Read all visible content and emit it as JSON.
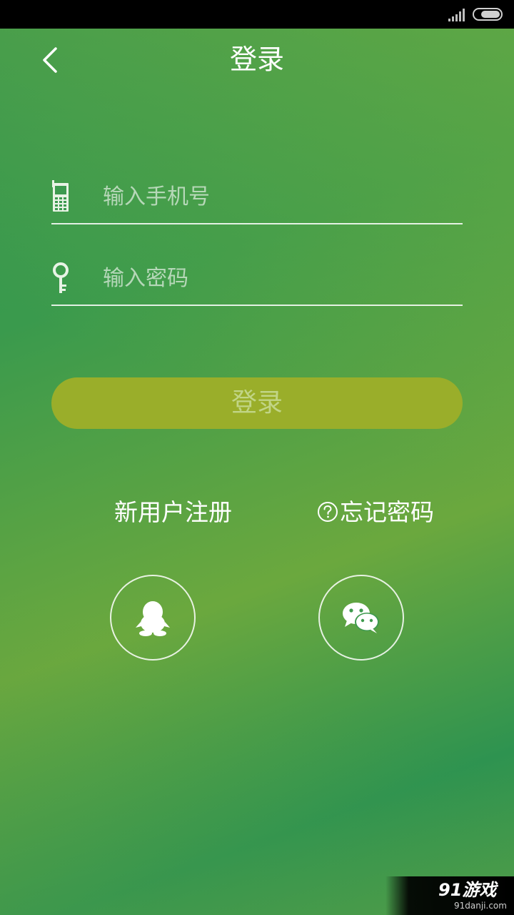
{
  "header": {
    "title": "登录"
  },
  "form": {
    "phone": {
      "value": "",
      "placeholder": "输入手机号"
    },
    "password": {
      "value": "",
      "placeholder": "输入密码"
    },
    "login_label": "登录"
  },
  "links": {
    "register": "新用户注册",
    "forgot": "忘记密码"
  },
  "social": {
    "qq_icon": "qq-icon",
    "wechat_icon": "wechat-icon"
  },
  "watermark": {
    "logo": "91游戏",
    "url": "91danji.com"
  },
  "colors": {
    "background": "#2f9352",
    "login_button": "#9aae2a",
    "text": "#ffffff"
  }
}
